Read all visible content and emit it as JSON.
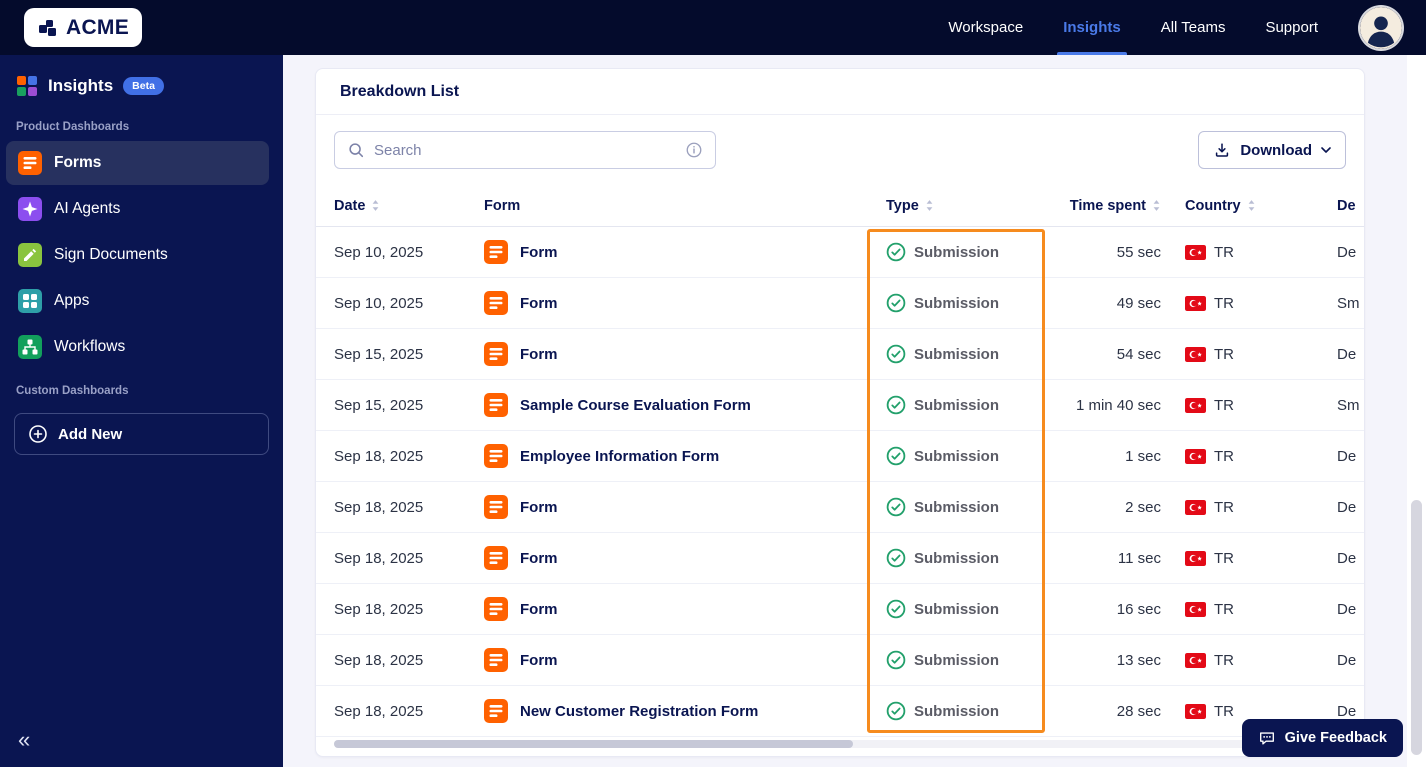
{
  "topbar": {
    "logo_text": "ACME",
    "nav": [
      {
        "label": "Workspace"
      },
      {
        "label": "Insights"
      },
      {
        "label": "All Teams"
      },
      {
        "label": "Support"
      }
    ]
  },
  "sidebar": {
    "title": "Insights",
    "beta_badge": "Beta",
    "sections": [
      {
        "label": "Product Dashboards",
        "items": [
          {
            "label": "Forms",
            "icon": "forms-icon",
            "active": true
          },
          {
            "label": "AI Agents",
            "icon": "ai-agents-icon",
            "active": false
          },
          {
            "label": "Sign Documents",
            "icon": "sign-documents-icon",
            "active": false
          },
          {
            "label": "Apps",
            "icon": "apps-icon",
            "active": false
          },
          {
            "label": "Workflows",
            "icon": "workflows-icon",
            "active": false
          }
        ]
      },
      {
        "label": "Custom Dashboards",
        "items": []
      }
    ],
    "add_new_label": "Add New",
    "collapse_glyph": "«"
  },
  "main": {
    "card_title": "Breakdown List",
    "search_placeholder": "Search",
    "download_label": "Download",
    "table": {
      "columns": [
        {
          "label": "Date",
          "sortable": true
        },
        {
          "label": "Form",
          "sortable": false
        },
        {
          "label": "Type",
          "sortable": true
        },
        {
          "label": "Time spent",
          "sortable": true
        },
        {
          "label": "Country",
          "sortable": true
        },
        {
          "label": "De",
          "sortable": false
        }
      ],
      "rows": [
        {
          "date": "Sep 10, 2025",
          "form": "Form",
          "type": "Submission",
          "time_spent": "55 sec",
          "country": "TR",
          "device": "De"
        },
        {
          "date": "Sep 10, 2025",
          "form": "Form",
          "type": "Submission",
          "time_spent": "49 sec",
          "country": "TR",
          "device": "Sm"
        },
        {
          "date": "Sep 15, 2025",
          "form": "Form",
          "type": "Submission",
          "time_spent": "54 sec",
          "country": "TR",
          "device": "De"
        },
        {
          "date": "Sep 15, 2025",
          "form": "Sample Course Evaluation Form",
          "type": "Submission",
          "time_spent": "1 min 40 sec",
          "country": "TR",
          "device": "Sm"
        },
        {
          "date": "Sep 18, 2025",
          "form": "Employee Information Form",
          "type": "Submission",
          "time_spent": "1 sec",
          "country": "TR",
          "device": "De"
        },
        {
          "date": "Sep 18, 2025",
          "form": "Form",
          "type": "Submission",
          "time_spent": "2 sec",
          "country": "TR",
          "device": "De"
        },
        {
          "date": "Sep 18, 2025",
          "form": "Form",
          "type": "Submission",
          "time_spent": "11 sec",
          "country": "TR",
          "device": "De"
        },
        {
          "date": "Sep 18, 2025",
          "form": "Form",
          "type": "Submission",
          "time_spent": "16 sec",
          "country": "TR",
          "device": "De"
        },
        {
          "date": "Sep 18, 2025",
          "form": "Form",
          "type": "Submission",
          "time_spent": "13 sec",
          "country": "TR",
          "device": "De"
        },
        {
          "date": "Sep 18, 2025",
          "form": "New Customer Registration Form",
          "type": "Submission",
          "time_spent": "28 sec",
          "country": "TR",
          "device": "De"
        }
      ]
    },
    "annotation": {
      "name": "type-column-highlight",
      "color": "#f68b1e"
    }
  },
  "feedback": {
    "label": "Give Feedback"
  },
  "colors": {
    "navy": "#0a1551",
    "accent_blue": "#4a7ae8",
    "orange": "#ff6100",
    "highlight_orange": "#f68b1e",
    "success_green": "#22a06b",
    "flag_red": "#e30a17"
  }
}
